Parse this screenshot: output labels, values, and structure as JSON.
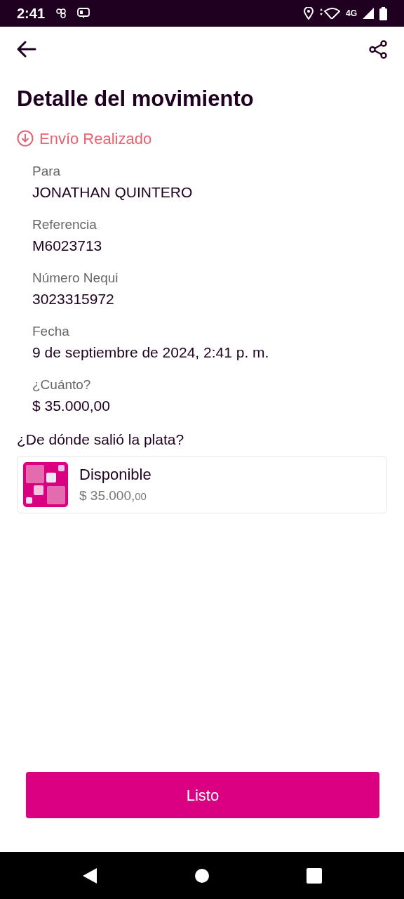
{
  "status_bar": {
    "time": "2:41",
    "network": "4G"
  },
  "title": "Detalle del movimiento",
  "status": {
    "label": "Envío Realizado",
    "color": "#e5646f"
  },
  "fields": [
    {
      "label": "Para",
      "value": "JONATHAN QUINTERO"
    },
    {
      "label": "Referencia",
      "value": "M6023713"
    },
    {
      "label": "Número Nequi",
      "value": "3023315972"
    },
    {
      "label": "Fecha",
      "value": "9 de septiembre de 2024, 2:41 p. m."
    },
    {
      "label": "¿Cuánto?",
      "value": "$ 35.000,00"
    }
  ],
  "source": {
    "heading": "¿De dónde salió la plata?",
    "name": "Disponible",
    "amount": "$ 35.000,",
    "cents": "00"
  },
  "button": "Listo"
}
